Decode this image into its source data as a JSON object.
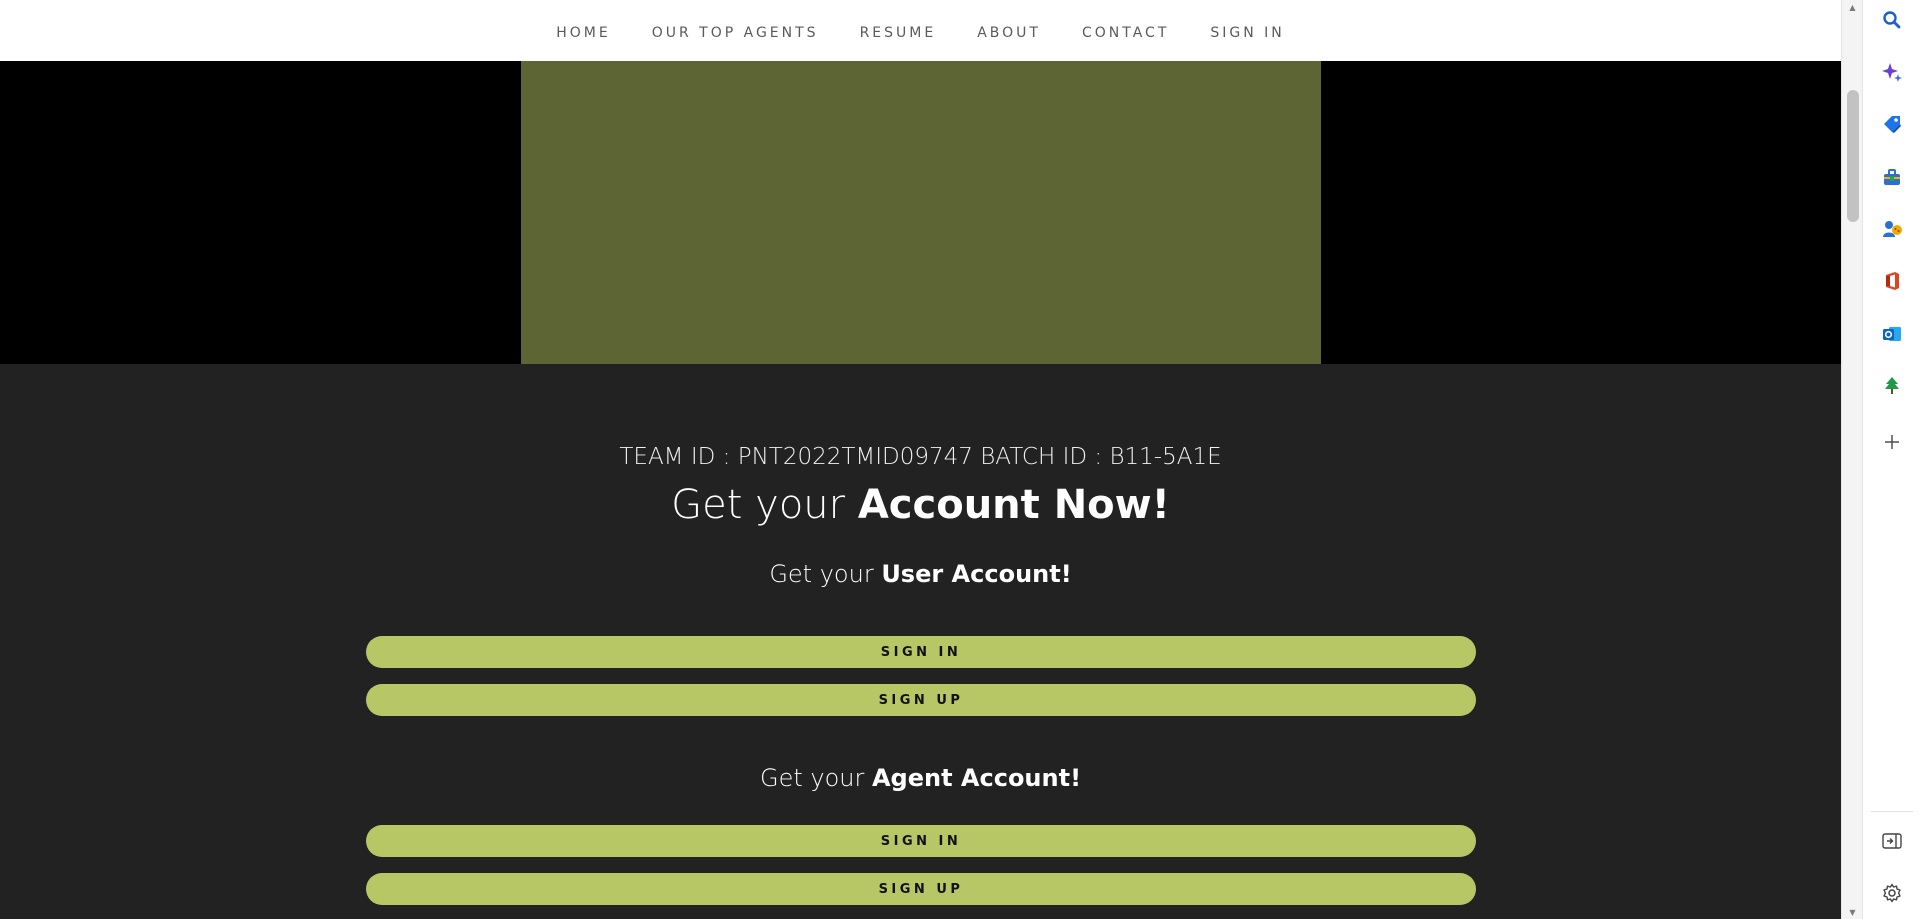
{
  "nav": {
    "items": [
      "HOME",
      "OUR TOP AGENTS",
      "RESUME",
      "ABOUT",
      "CONTACT",
      "SIGN IN"
    ]
  },
  "team_line": "TEAM ID : PNT2022TMID09747 BATCH ID : B11-5A1E",
  "headline": {
    "prefix": "Get your ",
    "bold": "Account Now!"
  },
  "user_section": {
    "prefix": "Get your ",
    "bold": "User Account!",
    "signin_label": "SIGN IN",
    "signup_label": "SIGN UP"
  },
  "agent_section": {
    "prefix": "Get your ",
    "bold": "Agent Account!",
    "signin_label": "SIGN IN",
    "signup_label": "SIGN UP"
  },
  "colors": {
    "accent": "#b8c765",
    "hero_media": "#5c6533",
    "background": "#222222"
  },
  "edge_sidebar": {
    "icons": [
      "search-icon",
      "copilot-icon",
      "shopping-tag-icon",
      "tools-icon",
      "games-icon",
      "office-icon",
      "outlook-icon",
      "tree-icon",
      "add-icon",
      "sidebar-collapse-icon",
      "settings-icon"
    ]
  }
}
